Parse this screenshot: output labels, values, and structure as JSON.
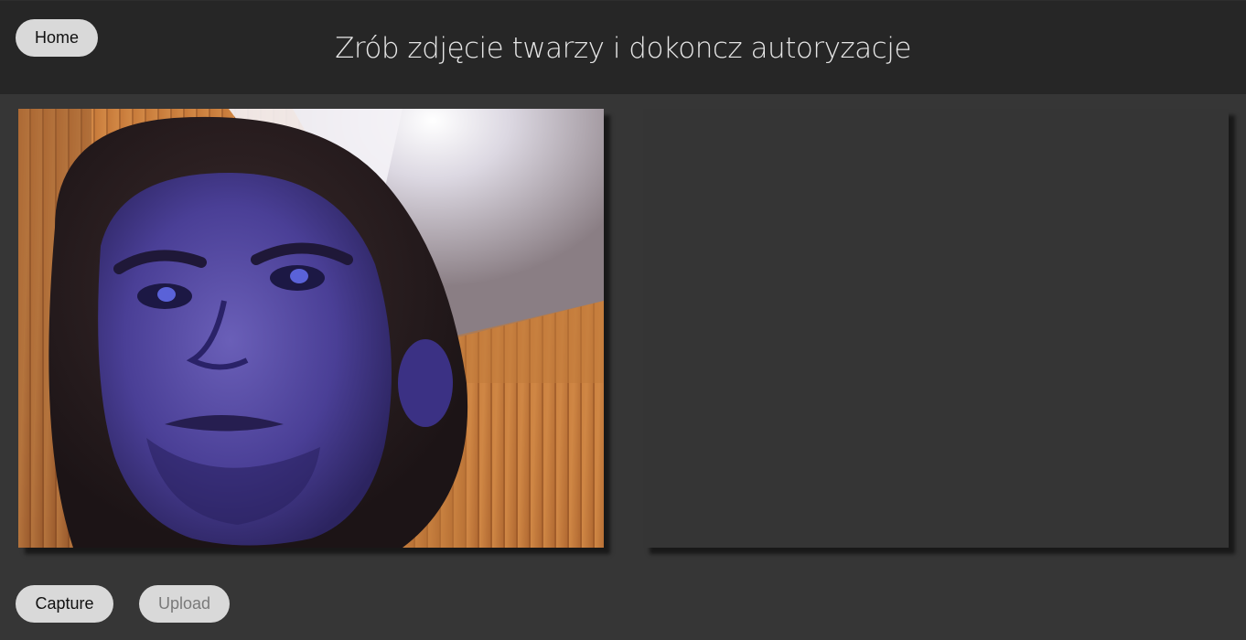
{
  "header": {
    "home_label": "Home",
    "title": "Zrób zdjęcie twarzy i dokoncz autoryzacje"
  },
  "controls": {
    "capture_label": "Capture",
    "upload_label": "Upload",
    "upload_enabled": false
  },
  "panels": {
    "live_video": "webcam-feed",
    "captured_photo": "empty"
  },
  "colors": {
    "page_background": "#363636",
    "header_background": "#262626",
    "button_background": "#d9d9d9",
    "title_text": "#e6e6e6",
    "disabled_text": "#7a7a7a"
  }
}
